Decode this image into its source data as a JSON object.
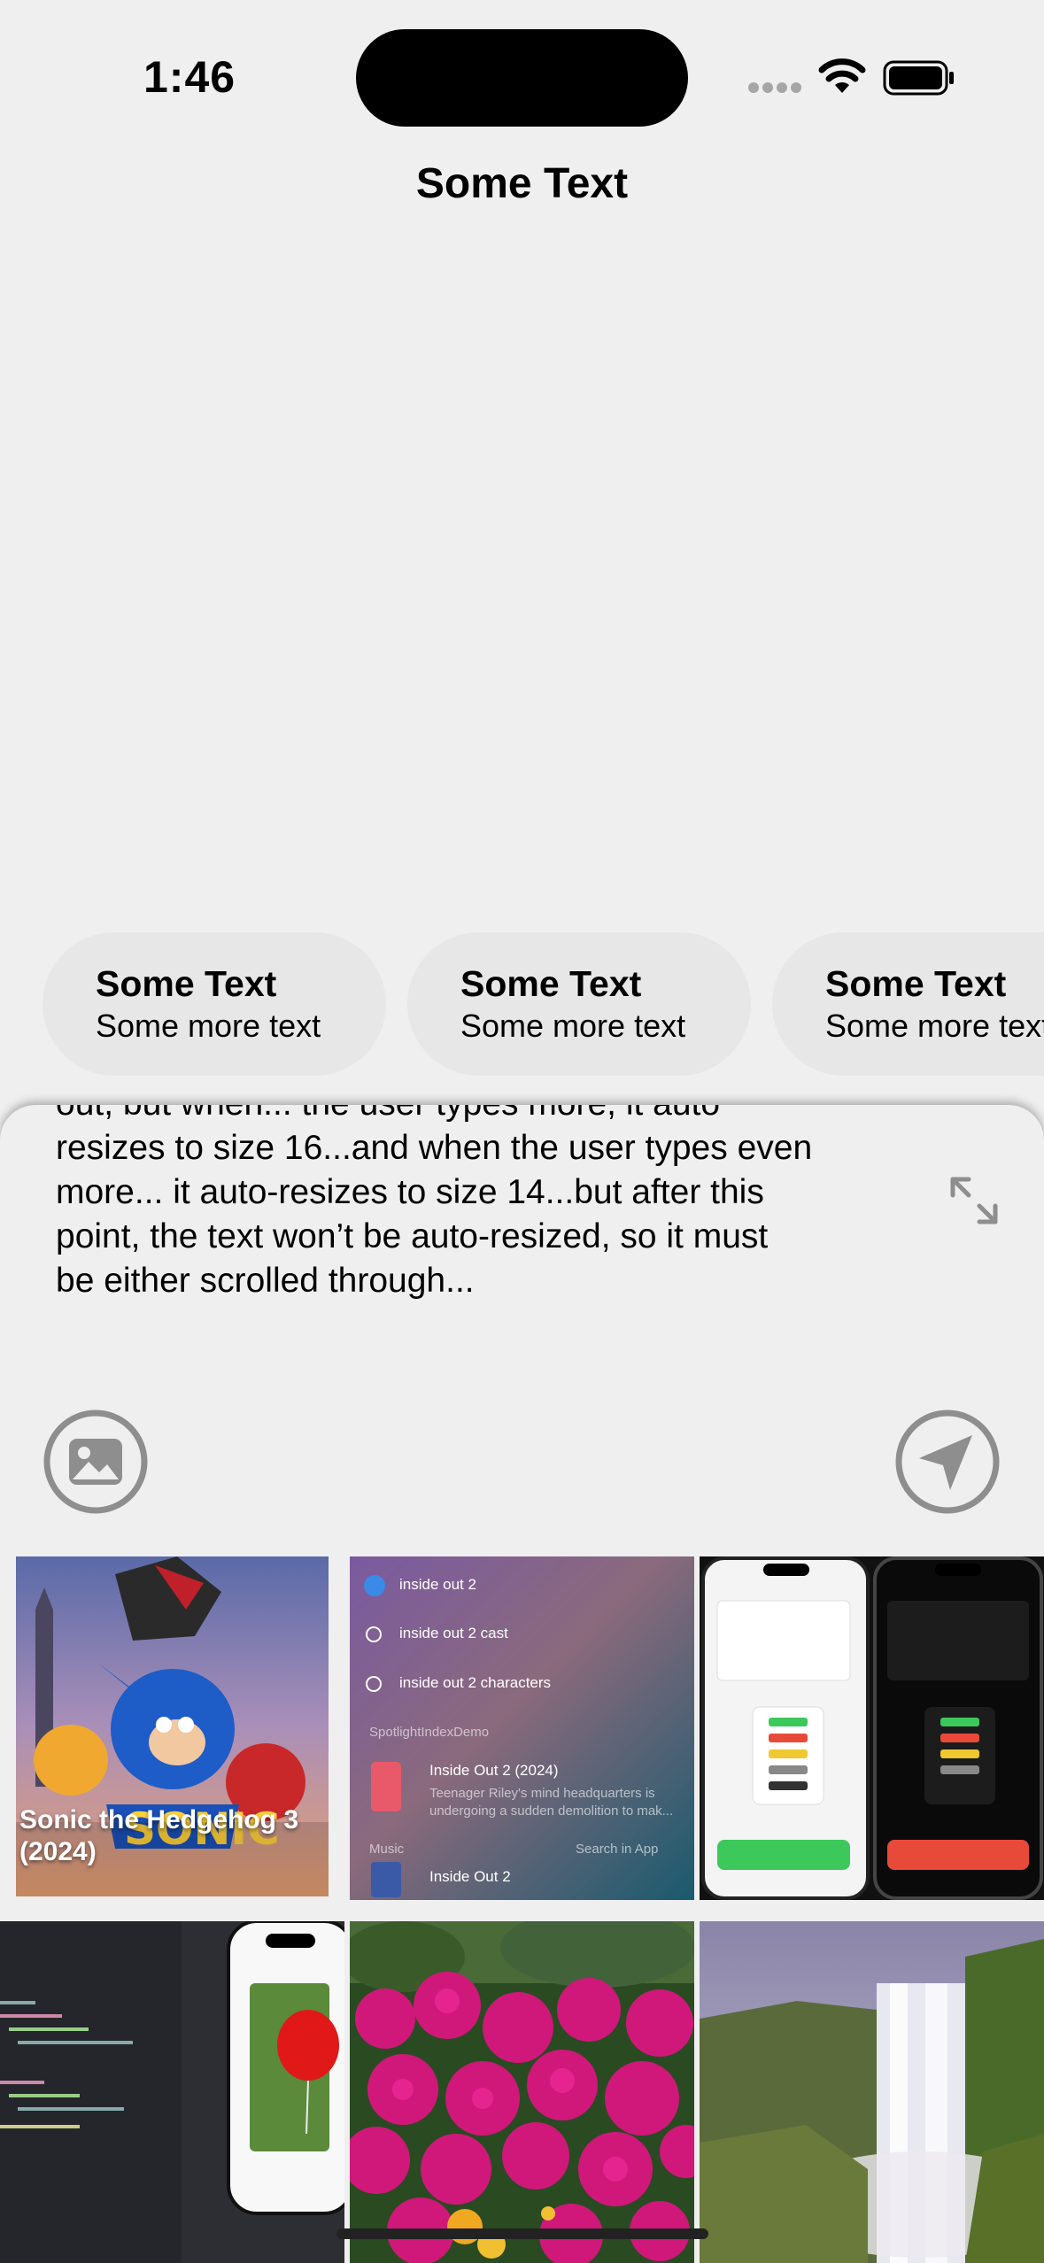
{
  "status_bar": {
    "time": "1:46"
  },
  "nav": {
    "title": "Some Text"
  },
  "suggestions": [
    {
      "title": "Some Text",
      "subtitle": "Some more text"
    },
    {
      "title": "Some Text",
      "subtitle": "Some more text"
    },
    {
      "title": "Some Text",
      "subtitle": "Some more text"
    }
  ],
  "composer": {
    "line0": "out, but when... the user types more, it auto",
    "line1": "resizes to size 16...and when the user types even",
    "line2": "more... it auto-resizes to size 14...but after this",
    "line3": "point, the text won’t be auto-resized, so it must",
    "line4": "be either scrolled through..."
  },
  "photos": {
    "poster_caption": "Sonic the Hedgehog 3 (2024)",
    "spotlight": {
      "row1": "inside out 2",
      "row2": "inside out 2 cast",
      "row3": "inside out 2 characters",
      "section": "SpotlightIndexDemo",
      "result_title": "Inside Out 2 (2024)",
      "result_desc": "Teenager Riley's mind headquarters is undergoing a sudden demolition to mak...",
      "music_label": "Music",
      "search_in_app": "Search in App",
      "music_result": "Inside Out 2"
    }
  },
  "colors": {
    "background": "#efefef",
    "chip": "#e7e7e7",
    "icon_gray": "#8e8e8e"
  }
}
